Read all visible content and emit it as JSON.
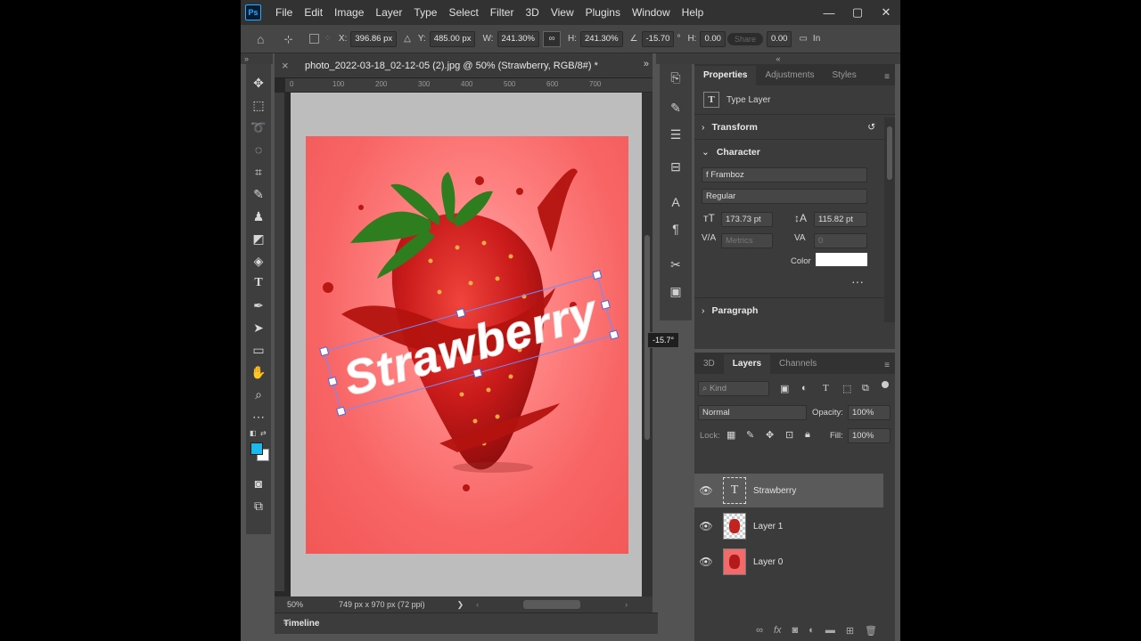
{
  "menubar": {
    "logo": "Ps",
    "items": [
      "File",
      "Edit",
      "Image",
      "Layer",
      "Type",
      "Select",
      "Filter",
      "3D",
      "View",
      "Plugins",
      "Window",
      "Help"
    ],
    "controls": [
      "minimize-icon",
      "maximize-icon",
      "close-icon"
    ]
  },
  "options": {
    "x_label": "X:",
    "x_value": "396.86 px",
    "y_label": "Y:",
    "y_value": "485.00 px",
    "w_label": "W:",
    "w_value": "241.30%",
    "h_label": "H:",
    "h_value": "241.30%",
    "angle_value": "-15.70",
    "angle_unit": "°",
    "hskew_label": "H:",
    "hskew_value": "0.00",
    "share_label": "Share",
    "vskew_value": "0.00",
    "interp_label": "In"
  },
  "document": {
    "tab_title": "photo_2022-03-18_02-12-05 (2).jpg @ 50% (Strawberry, RGB/8#) *",
    "ruler_ticks": [
      "0",
      "100",
      "200",
      "300",
      "400",
      "500",
      "600",
      "700"
    ],
    "canvas_text": "Strawberry",
    "zoom": "50%",
    "dimensions": "749 px x 970 px (72 ppi)",
    "angle_tooltip": "-15.7°"
  },
  "timeline": {
    "label": "Timeline"
  },
  "properties": {
    "tabs": [
      "Properties",
      "Adjustments",
      "Styles"
    ],
    "layer_type": "Type Layer",
    "sections": {
      "transform": "Transform",
      "character": "Character",
      "paragraph": "Paragraph"
    },
    "font_family": "f Framboz",
    "font_style": "Regular",
    "font_size": "173.73 pt",
    "leading": "115.82 pt",
    "kerning": "Metrics",
    "tracking": "0",
    "color_label": "Color",
    "color_value": "#ffffff"
  },
  "layers": {
    "tabs": [
      "3D",
      "Layers",
      "Channels"
    ],
    "kind_placeholder": "Kind",
    "blend_mode": "Normal",
    "opacity_label": "Opacity:",
    "opacity_value": "100%",
    "lock_label": "Lock:",
    "fill_label": "Fill:",
    "fill_value": "100%",
    "items": [
      {
        "name": "Strawberry",
        "type": "text"
      },
      {
        "name": "Layer 1",
        "type": "image"
      },
      {
        "name": "Layer 0",
        "type": "image"
      }
    ]
  },
  "colors": {
    "foreground": "#1fb8ea",
    "background": "#ffffff",
    "canvas_bg": "#f56060",
    "selected_layer": "#5a5a5a"
  }
}
